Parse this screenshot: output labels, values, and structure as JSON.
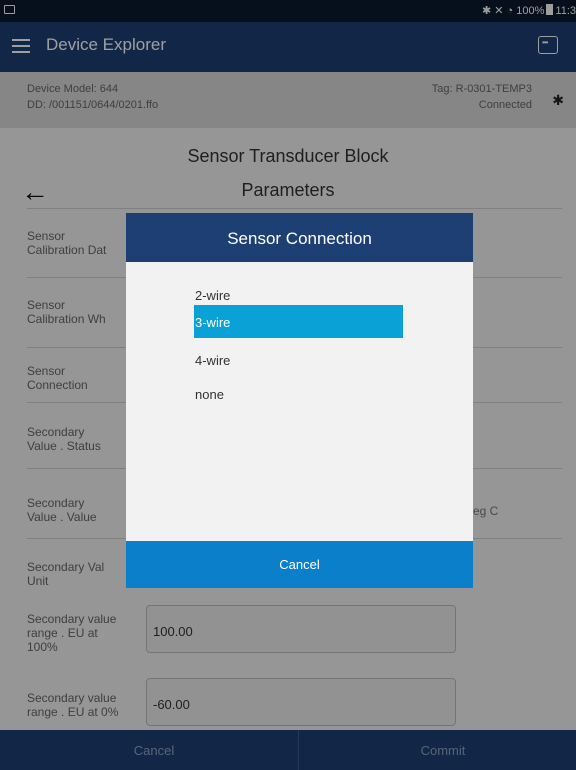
{
  "status_bar": {
    "time": "11:3",
    "battery": "100%",
    "icons": [
      "bluetooth-icon",
      "mute-icon",
      "wifi-icon",
      "battery-icon"
    ]
  },
  "app_bar": {
    "title": "Device Explorer"
  },
  "device": {
    "model": "Device Model: 644",
    "dd": "DD: /001151/0644/0201.ffo",
    "tag": "Tag: R-0301-TEMP3",
    "status": "Connected"
  },
  "page": {
    "title_line1": "Sensor Transducer Block",
    "title_line2": "Parameters"
  },
  "parameters": [
    {
      "label_line1": "Sensor",
      "label_line2": "Calibration Dat"
    },
    {
      "label_line1": "Sensor",
      "label_line2": "Calibration Wh"
    },
    {
      "label_line1": "Sensor",
      "label_line2": "Connection"
    },
    {
      "label_line1": "Secondary",
      "label_line2": "Value . Status"
    },
    {
      "label_line1": "Secondary",
      "label_line2": "Value . Value",
      "value": "eg C"
    },
    {
      "label_line1": "Secondary Val",
      "label_line2": "Unit"
    },
    {
      "label_line1": "Secondary value",
      "label_line2": "range . EU at",
      "label_line3": "100%",
      "value": "100.00"
    },
    {
      "label_line1": "Secondary value",
      "label_line2": "range . EU at 0%",
      "value": "-60.00"
    }
  ],
  "bottom_bar": {
    "cancel": "Cancel",
    "commit": "Commit"
  },
  "dialog": {
    "title": "Sensor Connection",
    "options": [
      "2-wire",
      "3-wire",
      "4-wire",
      "none"
    ],
    "selected": "3-wire",
    "cancel": "Cancel"
  },
  "colors": {
    "app_bar": "#1d3f73",
    "selected_option": "#0aa1d6",
    "dialog_cancel": "#0b7fc9"
  }
}
